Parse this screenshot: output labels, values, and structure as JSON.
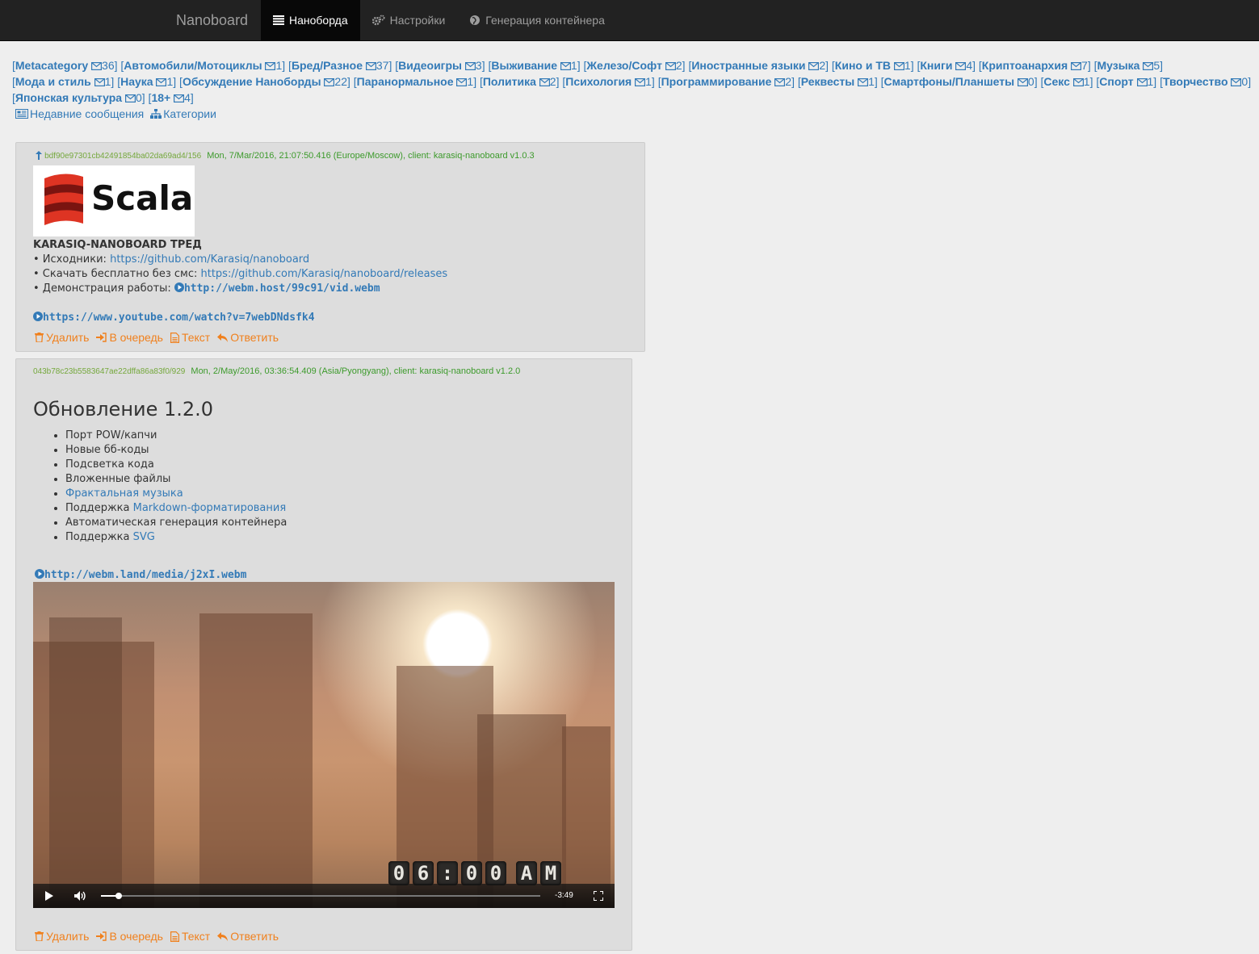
{
  "navbar": {
    "brand": "Nanoboard",
    "items": [
      {
        "label": "Нанoборда",
        "icon": "list-icon",
        "active": true
      },
      {
        "label": "Настройки",
        "icon": "cogs-icon",
        "active": false
      },
      {
        "label": "Генерация контейнера",
        "icon": "globe-icon",
        "active": false
      }
    ]
  },
  "categories": [
    {
      "name": "Metacategory",
      "count": "36"
    },
    {
      "name": "Автомобили/Мотоциклы",
      "count": "1"
    },
    {
      "name": "Бред/Разное",
      "count": "37"
    },
    {
      "name": "Видеоигры",
      "count": "3"
    },
    {
      "name": "Выживание",
      "count": "1"
    },
    {
      "name": "Железо/Софт",
      "count": "2"
    },
    {
      "name": "Иностранные языки",
      "count": "2"
    },
    {
      "name": "Кино и ТВ",
      "count": "1"
    },
    {
      "name": "Книги",
      "count": "4"
    },
    {
      "name": "Криптоанархия",
      "count": "7"
    },
    {
      "name": "Музыка",
      "count": "5"
    },
    {
      "name": "Мода и стиль",
      "count": "1"
    },
    {
      "name": "Наука",
      "count": "1"
    },
    {
      "name": "Обсуждение Наноборды",
      "count": "22"
    },
    {
      "name": "Паранормальное",
      "count": "1"
    },
    {
      "name": "Политика",
      "count": "2"
    },
    {
      "name": "Психология",
      "count": "1"
    },
    {
      "name": "Программирование",
      "count": "2"
    },
    {
      "name": "Реквесты",
      "count": "1"
    },
    {
      "name": "Смартфоны/Планшеты",
      "count": "0"
    },
    {
      "name": "Секс",
      "count": "1"
    },
    {
      "name": "Спорт",
      "count": "1"
    },
    {
      "name": "Творчество",
      "count": "0"
    },
    {
      "name": "Японская культура",
      "count": "0"
    },
    {
      "name": "18+",
      "count": "4"
    }
  ],
  "sublinks": {
    "recent": "Недавние сообщения",
    "categories": "Категории"
  },
  "post1": {
    "hash": "bdf90e97301cb42491854ba02da69ad4/156",
    "meta": "Mon, 7/Mar/2016, 21:07:50.416 (Europe/Moscow), client: karasiq-nanoboard v1.0.3",
    "logo_text": "Scala",
    "title": "KARASIQ-NANOBOARD ТРЕД",
    "lines": [
      {
        "label": "• Исходники: ",
        "link": "https://github.com/Karasiq/nanoboard"
      },
      {
        "label": "• Скачать бесплатно без смс: ",
        "link": "https://github.com/Karasiq/nanoboard/releases"
      },
      {
        "label": "• Демонстрация работы: ",
        "link": "http://webm.host/99c91/vid.webm"
      }
    ],
    "youtube": "https://www.youtube.com/watch?v=7webDNdsfk4"
  },
  "post2": {
    "hash": "043b78c23b5583647ae22dffa86a83f0/929",
    "meta": "Mon, 2/May/2016, 03:36:54.409 (Asia/Pyongyang), client: karasiq-nanoboard v1.2.0",
    "heading": "Обновление 1.2.0",
    "items": [
      {
        "pre": "Порт POW/капчи",
        "link": "",
        "post": ""
      },
      {
        "pre": "Новые бб-коды",
        "link": "",
        "post": ""
      },
      {
        "pre": "Подсветка кода",
        "link": "",
        "post": ""
      },
      {
        "pre": "Вложенные файлы",
        "link": "",
        "post": ""
      },
      {
        "pre": "",
        "link": "Фрактальная музыка",
        "post": ""
      },
      {
        "pre": "Поддержка ",
        "link": "Markdown-форматирования",
        "post": ""
      },
      {
        "pre": "Автоматическая генерация контейнера",
        "link": "",
        "post": ""
      },
      {
        "pre": "Поддержка ",
        "link": "SVG",
        "post": ""
      }
    ],
    "video_link": "http://webm.land/media/j2xI.webm",
    "clock": [
      "0",
      "6",
      ":",
      "0",
      "0",
      "",
      "A",
      "M"
    ],
    "video_time": "-3:49",
    "video_progress": 0.04
  },
  "actions": {
    "delete": "Удалить",
    "queue": "В очередь",
    "text": "Текст",
    "reply": "Ответить"
  },
  "colors": {
    "navbar_bg": "#222222",
    "link": "#337ab7",
    "meta_green": "#3c9a2b",
    "action_orange": "#f0801d"
  }
}
